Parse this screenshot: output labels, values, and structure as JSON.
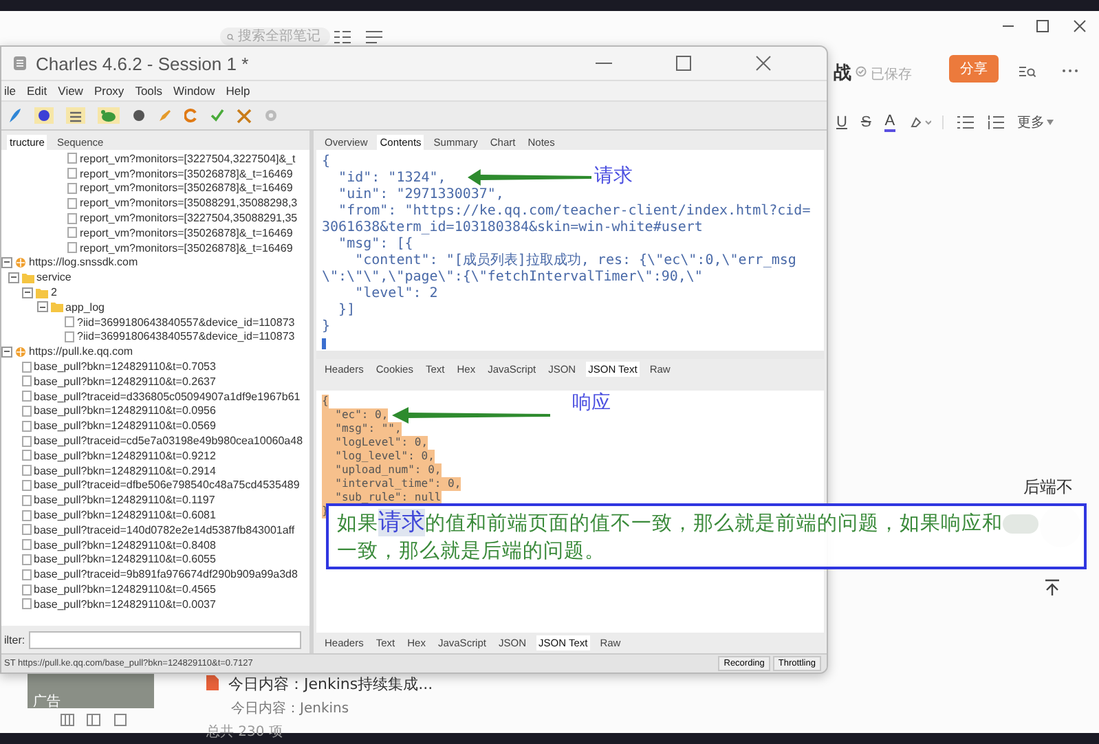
{
  "notes_app": {
    "search": {
      "placeholder": "搜索全部笔记"
    },
    "title": "战",
    "saved_status": "已保存",
    "share_button": "分享",
    "toolbar": [
      {
        "kind": "underline",
        "label": "U"
      },
      {
        "kind": "strike",
        "label": "S"
      },
      {
        "kind": "color",
        "label": "A"
      },
      {
        "kind": "highlight"
      },
      {
        "kind": "bullets"
      },
      {
        "kind": "numbers"
      },
      {
        "kind": "more",
        "label": "更多"
      }
    ],
    "side_note": "后端不",
    "ad_label": "广告",
    "note_item": {
      "title": "今日内容：Jenkins持续集成...",
      "snippet": "今日内容：Jenkins",
      "total": "总共 230 项"
    }
  },
  "charles": {
    "title": "Charles 4.6.2 - Session 1 *",
    "menu": [
      "ile",
      "Edit",
      "View",
      "Proxy",
      "Tools",
      "Window",
      "Help"
    ],
    "left_tabs": [
      {
        "label": "tructure",
        "selected": true
      },
      {
        "label": "Sequence",
        "selected": false
      }
    ],
    "leading_rows": [
      "report_vm?monitors=[3227504,3227504]&_t",
      "report_vm?monitors=[35026878]&_t=16469",
      "report_vm?monitors=[35026878]&_t=16469",
      "report_vm?monitors=[35088291,35088298,3",
      "report_vm?monitors=[3227504,35088291,35",
      "report_vm?monitors=[35026878]&_t=16469",
      "report_vm?monitors=[35026878]&_t=16469"
    ],
    "tree": [
      {
        "label": "https://log.snssdk.com",
        "kind": "host",
        "expanded": true,
        "children": [
          {
            "label": "service",
            "kind": "folder",
            "expanded": true,
            "children": [
              {
                "label": "2",
                "kind": "folder",
                "expanded": true,
                "children": [
                  {
                    "label": "app_log",
                    "kind": "folder",
                    "expanded": true,
                    "children": [
                      {
                        "label": "?iid=3699180643840557&device_id=110873",
                        "kind": "file"
                      },
                      {
                        "label": "?iid=3699180643840557&device_id=110873",
                        "kind": "file"
                      }
                    ]
                  }
                ]
              }
            ]
          }
        ]
      },
      {
        "label": "https://pull.ke.qq.com",
        "kind": "host",
        "expanded": true,
        "children": [
          {
            "label": "base_pull?bkn=124829110&t=0.7053",
            "kind": "file"
          },
          {
            "label": "base_pull?bkn=124829110&t=0.2637",
            "kind": "file"
          },
          {
            "label": "base_pull?traceid=d336805c05094907a1df9e1967b61",
            "kind": "file"
          },
          {
            "label": "base_pull?bkn=124829110&t=0.0956",
            "kind": "file"
          },
          {
            "label": "base_pull?bkn=124829110&t=0.0569",
            "kind": "file"
          },
          {
            "label": "base_pull?traceid=cd5e7a03198e49b980cea10060a48",
            "kind": "file"
          },
          {
            "label": "base_pull?bkn=124829110&t=0.9212",
            "kind": "file"
          },
          {
            "label": "base_pull?bkn=124829110&t=0.2914",
            "kind": "file"
          },
          {
            "label": "base_pull?traceid=dfbe506e798540c48a75cd4535489",
            "kind": "file"
          },
          {
            "label": "base_pull?bkn=124829110&t=0.1197",
            "kind": "file"
          },
          {
            "label": "base_pull?bkn=124829110&t=0.6081",
            "kind": "file"
          },
          {
            "label": "base_pull?traceid=140d0782e2e14d5387fb843001aff",
            "kind": "file"
          },
          {
            "label": "base_pull?bkn=124829110&t=0.8408",
            "kind": "file"
          },
          {
            "label": "base_pull?bkn=124829110&t=0.6055",
            "kind": "file"
          },
          {
            "label": "base_pull?traceid=9b891fa976674df290b909a99a3d8",
            "kind": "file"
          },
          {
            "label": "base_pull?bkn=124829110&t=0.4565",
            "kind": "file"
          },
          {
            "label": "base_pull?bkn=124829110&t=0.0037",
            "kind": "file"
          }
        ]
      }
    ],
    "filter_label": "ilter:",
    "request_tabs": [
      {
        "label": "Overview",
        "selected": false
      },
      {
        "label": "Contents",
        "selected": true
      },
      {
        "label": "Summary",
        "selected": false
      },
      {
        "label": "Chart",
        "selected": false
      },
      {
        "label": "Notes",
        "selected": false
      }
    ],
    "request_lines": [
      "{",
      "  \"id\": \"1324\",",
      "  \"uin\": \"2971330037\",",
      "  \"from\": \"https://ke.qq.com/teacher-client/index.html?cid=3061638&term_id=103180384&skin=win-white#usert",
      "  \"msg\": [{",
      "    \"content\": \"[成员列表]拉取成功, res: {\\\"ec\\\":0,\\\"err_msg\\\":\\\"\\\",\\\"page\\\":{\\\"fetchIntervalTimer\\\":90,\\\"",
      "    \"level\": 2",
      "  }]",
      "}"
    ],
    "request_view_tabs": [
      {
        "label": "Headers",
        "selected": false
      },
      {
        "label": "Cookies",
        "selected": false
      },
      {
        "label": "Text",
        "selected": false
      },
      {
        "label": "Hex",
        "selected": false
      },
      {
        "label": "JavaScript",
        "selected": false
      },
      {
        "label": "JSON",
        "selected": false
      },
      {
        "label": "JSON Text",
        "selected": true
      },
      {
        "label": "Raw",
        "selected": false
      }
    ],
    "response_lines": [
      "{",
      "  \"ec\": 0,",
      "  \"msg\": \"\",",
      "  \"logLevel\": 0,",
      "  \"log_level\": 0,",
      "  \"upload_num\": 0,",
      "  \"interval_time\": 0,",
      "  \"sub_rule\": null",
      "}"
    ],
    "response_view_tabs": [
      {
        "label": "Headers",
        "selected": false
      },
      {
        "label": "Text",
        "selected": false
      },
      {
        "label": "Hex",
        "selected": false
      },
      {
        "label": "JavaScript",
        "selected": false
      },
      {
        "label": "JSON",
        "selected": false
      },
      {
        "label": "JSON Text",
        "selected": true
      },
      {
        "label": "Raw",
        "selected": false
      }
    ],
    "status_url": "ST https://pull.ke.qq.com/base_pull?bkn=124829110&t=0.7127",
    "status_buttons": [
      "Recording",
      "Throttling"
    ]
  },
  "annotations": {
    "request_label": "请求",
    "response_label": "响应",
    "note": {
      "before": "如果",
      "highlight": "请求",
      "line1_rest": "的值和前端页面的值不一致，那么就是前端的问题，如果响应和",
      "line2": "一致，那么就是后端的问题。"
    }
  }
}
